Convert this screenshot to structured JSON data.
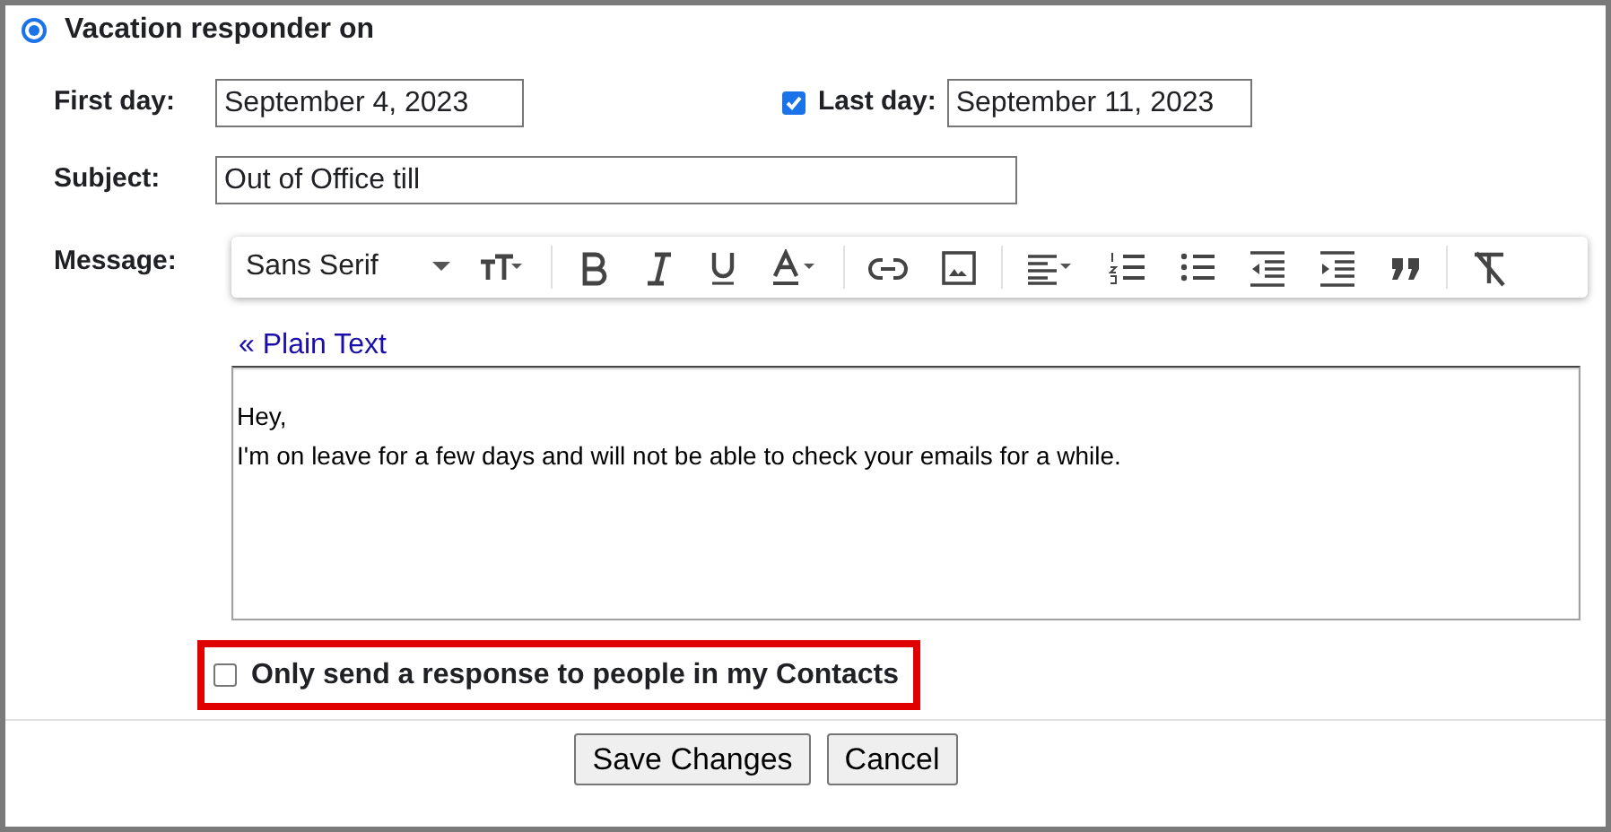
{
  "responder": {
    "label": "Vacation responder on",
    "selected": true
  },
  "first_day": {
    "label": "First day:",
    "value": "September 4, 2023"
  },
  "last_day": {
    "label": "Last day:",
    "value": "September 11, 2023",
    "checked": true
  },
  "subject": {
    "label": "Subject:",
    "value": "Out of Office till"
  },
  "message": {
    "label": "Message:",
    "font": "Sans Serif",
    "plain_text_link": "« Plain Text",
    "lines": [
      "Hey,",
      "I'm on leave for a few days and will not be able to check your emails for a while."
    ]
  },
  "contacts_only": {
    "label": "Only send a response to people in my Contacts",
    "checked": false,
    "highlighted": true
  },
  "buttons": [
    "Save Changes",
    "Cancel"
  ]
}
